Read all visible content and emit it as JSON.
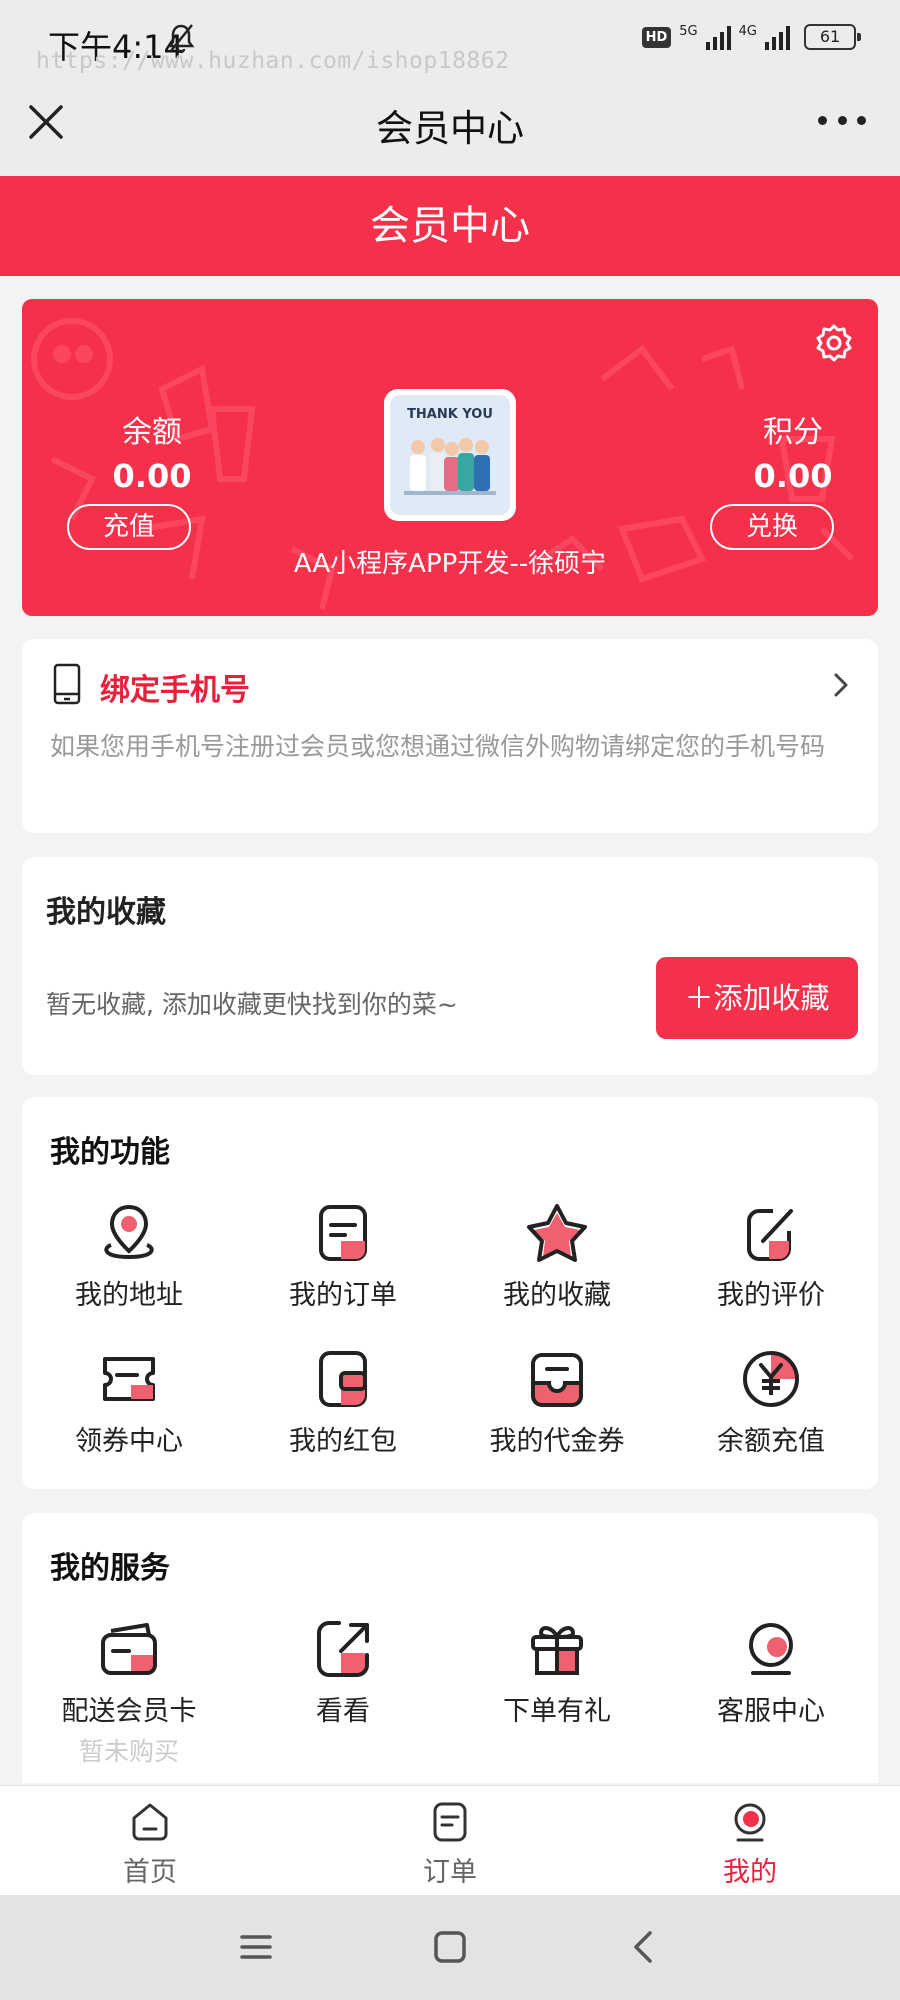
{
  "status_bar": {
    "time": "下午4:14",
    "watermark": "https://www.huzhan.com/ishop18862",
    "hd": "HD",
    "net1": "5G",
    "net2": "4G",
    "battery": "61"
  },
  "nav": {
    "title": "会员中心",
    "close_icon": "close-icon",
    "more_icon": "more-icon"
  },
  "header": {
    "title": "会员中心"
  },
  "member_card": {
    "balance_label": "余额",
    "balance_value": "0.00",
    "recharge_button": "充值",
    "points_label": "积分",
    "points_value": "0.00",
    "exchange_button": "兑换",
    "avatar_text": "THANK YOU",
    "user_name": "AA小程序APP开发--徐硕宁"
  },
  "bind_phone": {
    "title": "绑定手机号",
    "description": "如果您用手机号注册过会员或您想通过微信外购物请绑定您的手机号码"
  },
  "favorites": {
    "title": "我的收藏",
    "empty_text": "暂无收藏, 添加收藏更快找到你的菜~",
    "add_button": "＋添加收藏"
  },
  "functions": {
    "title": "我的功能",
    "items": [
      {
        "label": "我的地址",
        "icon": "location-icon"
      },
      {
        "label": "我的订单",
        "icon": "order-icon"
      },
      {
        "label": "我的收藏",
        "icon": "star-icon"
      },
      {
        "label": "我的评价",
        "icon": "review-icon"
      },
      {
        "label": "领券中心",
        "icon": "coupon-icon"
      },
      {
        "label": "我的红包",
        "icon": "wallet-icon"
      },
      {
        "label": "我的代金券",
        "icon": "voucher-icon"
      },
      {
        "label": "余额充值",
        "icon": "yen-icon"
      }
    ]
  },
  "services": {
    "title": "我的服务",
    "items": [
      {
        "label": "配送会员卡",
        "sub": "暂未购买",
        "icon": "card-icon"
      },
      {
        "label": "看看",
        "sub": "",
        "icon": "share-icon"
      },
      {
        "label": "下单有礼",
        "sub": "",
        "icon": "gift-icon"
      },
      {
        "label": "客服中心",
        "sub": "",
        "icon": "service-icon"
      }
    ]
  },
  "tabbar": {
    "items": [
      {
        "label": "首页",
        "icon": "home-icon",
        "active": false
      },
      {
        "label": "订单",
        "icon": "order-icon",
        "active": false
      },
      {
        "label": "我的",
        "icon": "profile-icon",
        "active": true
      }
    ]
  },
  "colors": {
    "brand_red": "#f5304b",
    "accent_red": "#e5213b",
    "icon_pink": "#f0606f"
  }
}
